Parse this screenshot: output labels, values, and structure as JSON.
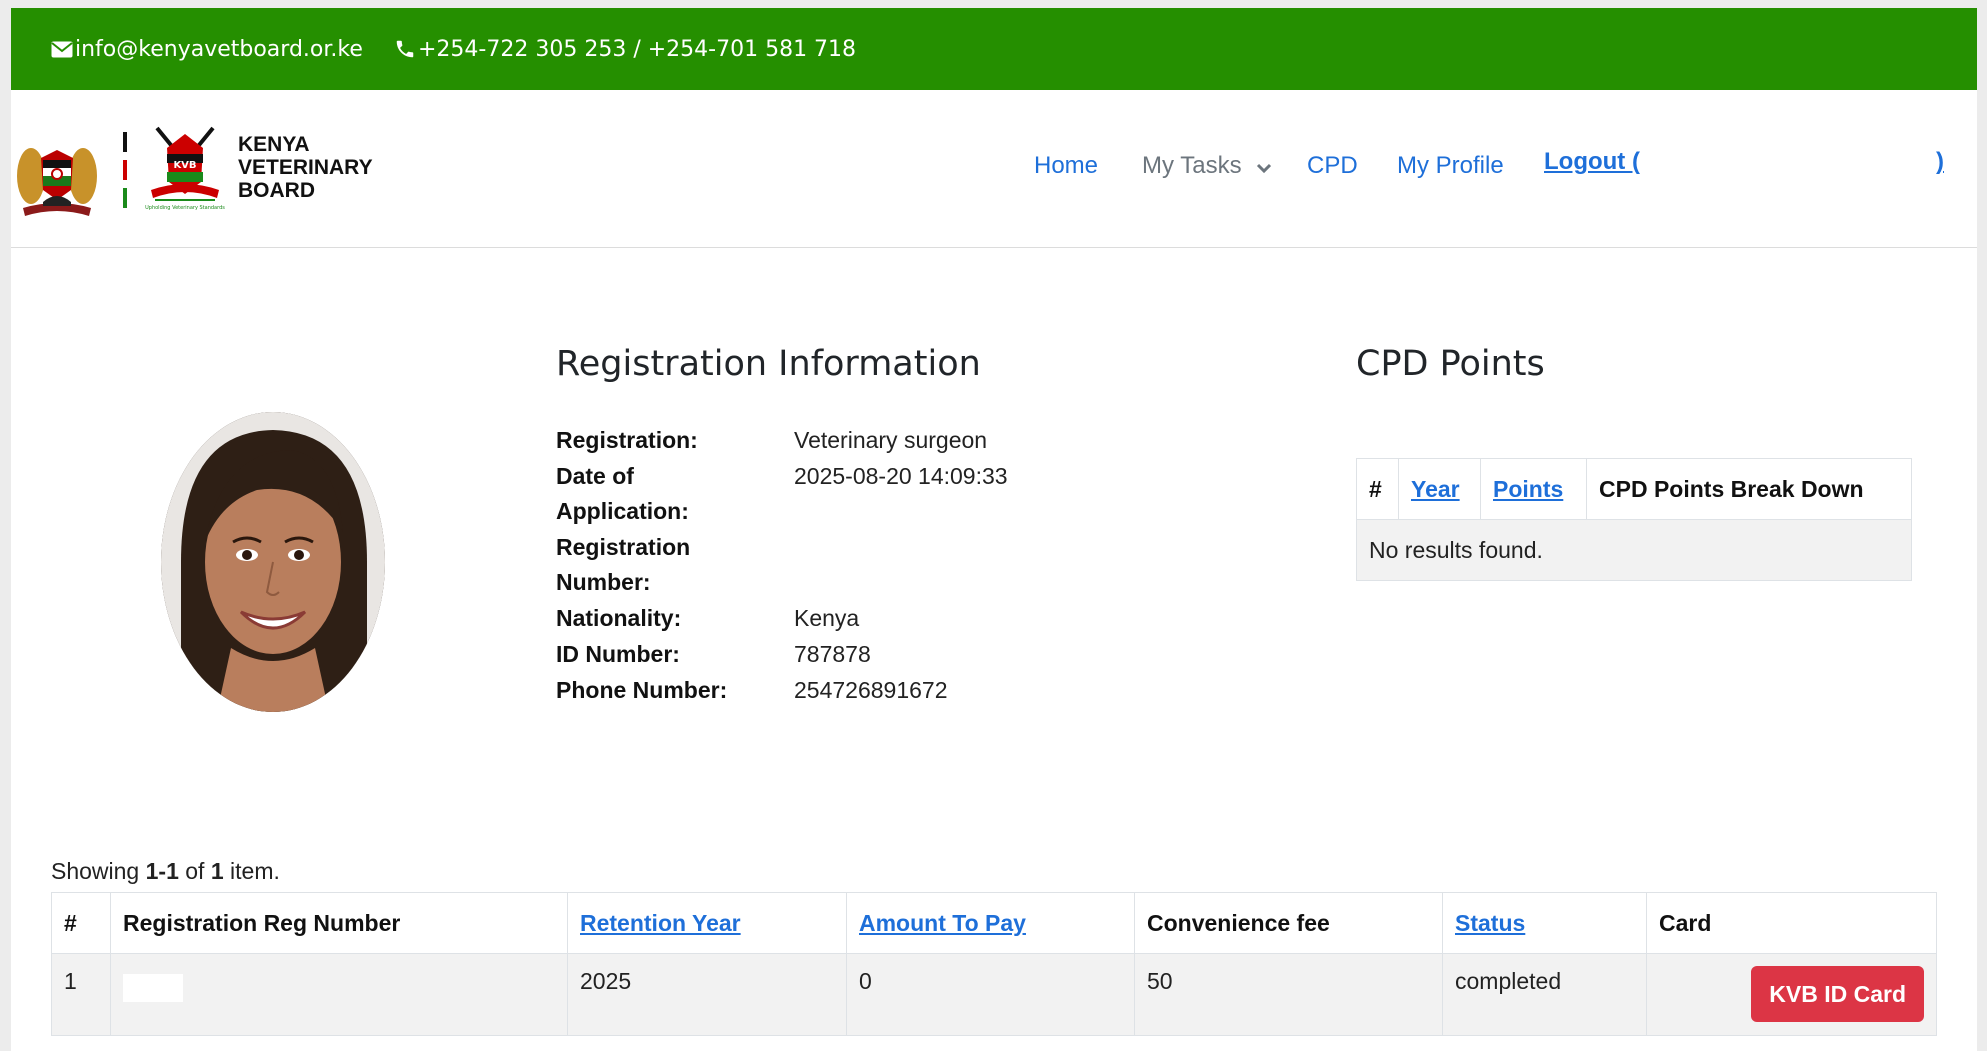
{
  "topbar": {
    "email": "info@kenyavetboard.or.ke",
    "phone": "+254-722 305 253 / +254-701 581 718"
  },
  "brand": {
    "line1": "KENYA",
    "line2": "VETERINARY",
    "line3": "BOARD",
    "emblem_text": "KVB"
  },
  "nav": {
    "home": "Home",
    "my_tasks": "My Tasks",
    "cpd": "CPD",
    "my_profile": "My Profile",
    "logout_open": "Logout (",
    "logout_close": ")"
  },
  "registration": {
    "title": "Registration Information",
    "fields": [
      {
        "label": "Registration:",
        "value": "Veterinary surgeon"
      },
      {
        "label": "Date of Application:",
        "value": "2025-08-20 14:09:33"
      },
      {
        "label": "Registration Number:",
        "value": ""
      },
      {
        "label": "Nationality:",
        "value": "Kenya"
      },
      {
        "label": "ID Number:",
        "value": "787878"
      },
      {
        "label": "Phone Number:",
        "value": "254726891672"
      }
    ]
  },
  "cpd": {
    "title": "CPD Points",
    "headers": [
      "#",
      "Year",
      "Points",
      "CPD Points Break Down"
    ],
    "empty_message": "No results found."
  },
  "retention": {
    "summary_prefix": "Showing ",
    "summary_range": "1-1",
    "summary_of": " of ",
    "summary_total": "1",
    "summary_suffix": " item.",
    "headers": [
      "#",
      "Registration Reg Number",
      "Retention Year",
      "Amount To Pay",
      "Convenience fee",
      "Status",
      "Card"
    ],
    "rows": [
      {
        "num": "1",
        "reg_number": "",
        "year": "2025",
        "amount": "0",
        "fee": "50",
        "status": "completed",
        "card_button": "KVB ID Card"
      }
    ]
  },
  "colors": {
    "topbar": "#258f00",
    "link": "#1e6fd9",
    "danger": "#dc3545"
  }
}
